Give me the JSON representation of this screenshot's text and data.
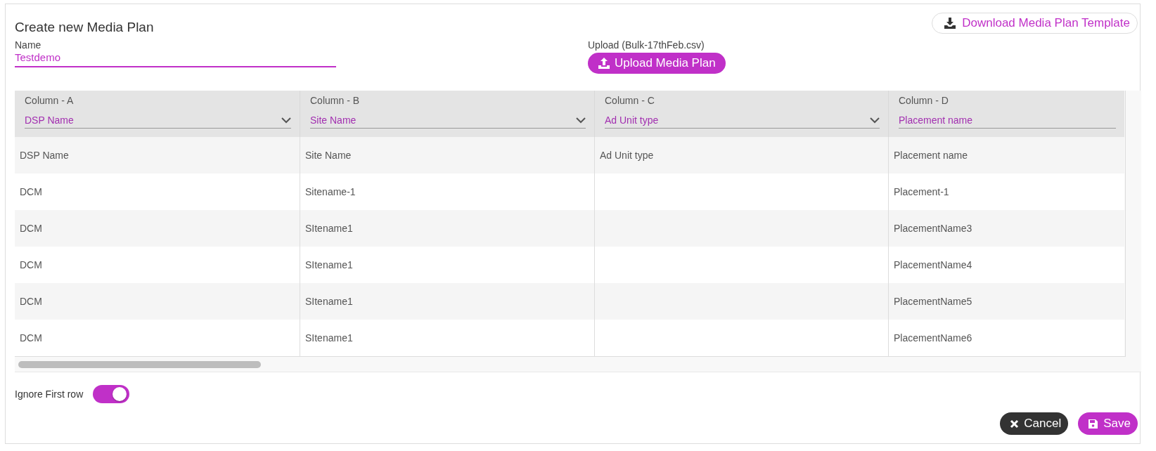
{
  "title": "Create new Media Plan",
  "download_button": "Download Media Plan Template",
  "name_field": {
    "label": "Name",
    "value": "Testdemo"
  },
  "upload": {
    "label": "Upload (Bulk-17thFeb.csv)",
    "button": "Upload Media Plan"
  },
  "table": {
    "columns": [
      {
        "heading": "Column - A",
        "mapping": "DSP Name",
        "kind": "select"
      },
      {
        "heading": "Column - B",
        "mapping": "Site Name",
        "kind": "select"
      },
      {
        "heading": "Column - C",
        "mapping": "Ad Unit type",
        "kind": "select"
      },
      {
        "heading": "Column - D",
        "mapping": "Placement name",
        "kind": "text"
      }
    ],
    "rows": [
      [
        "DSP Name",
        "Site Name",
        "Ad Unit type",
        "Placement name"
      ],
      [
        "DCM",
        "Sitename-1",
        "",
        "Placement-1"
      ],
      [
        "DCM",
        "SItename1",
        "",
        "PlacementName3"
      ],
      [
        "DCM",
        "SItename1",
        "",
        "PlacementName4"
      ],
      [
        "DCM",
        "SItename1",
        "",
        "PlacementName5"
      ],
      [
        "DCM",
        "SItename1",
        "",
        "PlacementName6"
      ]
    ]
  },
  "ignore_first_row": {
    "label": "Ignore First row",
    "on": true
  },
  "buttons": [
    {
      "label": "Cancel",
      "kind": "cancel"
    },
    {
      "label": "Save",
      "kind": "save"
    }
  ]
}
